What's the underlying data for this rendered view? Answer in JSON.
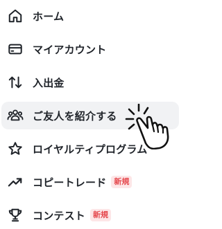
{
  "menu": {
    "items": [
      {
        "label": "ホーム",
        "icon": "home-icon"
      },
      {
        "label": "マイアカウント",
        "icon": "wallet-icon"
      },
      {
        "label": "入出金",
        "icon": "transfer-arrows-icon"
      },
      {
        "label": "ご友人を紹介する",
        "icon": "users-icon",
        "active": true
      },
      {
        "label": "ロイヤルティプログラム",
        "icon": "star-icon"
      },
      {
        "label": "コピートレード",
        "icon": "trending-up-icon",
        "badge": "新規"
      },
      {
        "label": "コンテスト",
        "icon": "trophy-icon",
        "badge": "新規"
      }
    ]
  },
  "colors": {
    "text": "#1f2329",
    "active_background": "#f1f2f4",
    "badge_text": "#e5484d",
    "badge_background": "#fde6e7"
  },
  "cursor": {
    "icon": "pointer-hand-click-icon"
  }
}
